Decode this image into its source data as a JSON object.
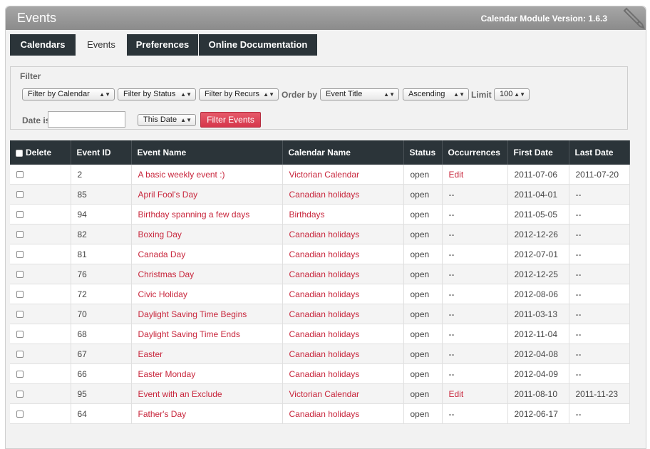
{
  "header": {
    "title": "Events",
    "version": "Calendar Module Version: 1.6.3"
  },
  "tabs": [
    {
      "label": "Calendars",
      "active": false
    },
    {
      "label": "Events",
      "active": true
    },
    {
      "label": "Preferences",
      "active": false
    },
    {
      "label": "Online Documentation",
      "active": false
    }
  ],
  "filter": {
    "legend": "Filter",
    "calendar": "Filter by Calendar",
    "status": "Filter by Status",
    "recurs": "Filter by Recurs",
    "order_by_label": "Order by",
    "order_field": "Event Title",
    "order_dir": "Ascending",
    "limit_label": "Limit",
    "limit": "100",
    "date_is_label": "Date is",
    "date_value": "",
    "date_mode": "This Date",
    "submit": "Filter Events"
  },
  "table": {
    "headers": [
      "Delete",
      "Event ID",
      "Event Name",
      "Calendar Name",
      "Status",
      "Occurrences",
      "First Date",
      "Last Date"
    ],
    "rows": [
      {
        "id": "2",
        "name": "A basic weekly event :)",
        "calendar": "Victorian Calendar",
        "status": "open",
        "occurrences": "Edit",
        "first": "2011-07-06",
        "last": "2011-07-20"
      },
      {
        "id": "85",
        "name": "April Fool's Day",
        "calendar": "Canadian holidays",
        "status": "open",
        "occurrences": "--",
        "first": "2011-04-01",
        "last": "--"
      },
      {
        "id": "94",
        "name": "Birthday spanning a few days",
        "calendar": "Birthdays",
        "status": "open",
        "occurrences": "--",
        "first": "2011-05-05",
        "last": "--"
      },
      {
        "id": "82",
        "name": "Boxing Day",
        "calendar": "Canadian holidays",
        "status": "open",
        "occurrences": "--",
        "first": "2012-12-26",
        "last": "--"
      },
      {
        "id": "81",
        "name": "Canada Day",
        "calendar": "Canadian holidays",
        "status": "open",
        "occurrences": "--",
        "first": "2012-07-01",
        "last": "--"
      },
      {
        "id": "76",
        "name": "Christmas Day",
        "calendar": "Canadian holidays",
        "status": "open",
        "occurrences": "--",
        "first": "2012-12-25",
        "last": "--"
      },
      {
        "id": "72",
        "name": "Civic Holiday",
        "calendar": "Canadian holidays",
        "status": "open",
        "occurrences": "--",
        "first": "2012-08-06",
        "last": "--"
      },
      {
        "id": "70",
        "name": "Daylight Saving Time Begins",
        "calendar": "Canadian holidays",
        "status": "open",
        "occurrences": "--",
        "first": "2011-03-13",
        "last": "--"
      },
      {
        "id": "68",
        "name": "Daylight Saving Time Ends",
        "calendar": "Canadian holidays",
        "status": "open",
        "occurrences": "--",
        "first": "2012-11-04",
        "last": "--"
      },
      {
        "id": "67",
        "name": "Easter",
        "calendar": "Canadian holidays",
        "status": "open",
        "occurrences": "--",
        "first": "2012-04-08",
        "last": "--"
      },
      {
        "id": "66",
        "name": "Easter Monday",
        "calendar": "Canadian holidays",
        "status": "open",
        "occurrences": "--",
        "first": "2012-04-09",
        "last": "--"
      },
      {
        "id": "95",
        "name": "Event with an Exclude",
        "calendar": "Victorian Calendar",
        "status": "open",
        "occurrences": "Edit",
        "first": "2011-08-10",
        "last": "2011-11-23"
      },
      {
        "id": "64",
        "name": "Father's Day",
        "calendar": "Canadian holidays",
        "status": "open",
        "occurrences": "--",
        "first": "2012-06-17",
        "last": "--"
      }
    ]
  },
  "colors": {
    "accent": "#c8263c",
    "dark": "#2b3439"
  }
}
